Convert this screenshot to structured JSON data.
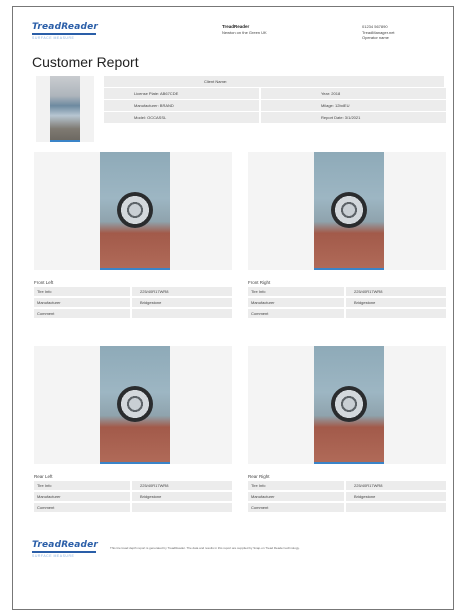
{
  "header": {
    "logo_text": "TreadReader",
    "logo_tag": "SURFACE MEASURE",
    "company_name": "TreadReader",
    "address": "Newton on the Green UK",
    "phone": "01234 567890",
    "email": "TreadManager.net",
    "operator": "Operator name"
  },
  "title": "Customer Report",
  "summary": {
    "client_name": "Client Name:",
    "license_plate": "License Plate: AB67CDE",
    "year": "Year: 2018",
    "manufacturer": "Manufacturer: BRAND",
    "mileage": "Milage: 12bdEU",
    "model": "Model: OCCASSL",
    "report_date": "Report Date: 3/1/2021"
  },
  "tyres": [
    {
      "position": "Front Left",
      "tire_info_label": "Tire Info",
      "tire_info": "225/40R17WR8",
      "manufacturer_label": "Manufacturer",
      "manufacturer": "Bridgestone",
      "comment_label": "Comment",
      "comment": ""
    },
    {
      "position": "Front Right",
      "tire_info_label": "Tire Info",
      "tire_info": "225/40R17WR8",
      "manufacturer_label": "Manufacturer",
      "manufacturer": "Bridgestone",
      "comment_label": "Comment",
      "comment": ""
    },
    {
      "position": "Rear Left",
      "tire_info_label": "Tire Info",
      "tire_info": "225/40R17WR8",
      "manufacturer_label": "Manufacturer",
      "manufacturer": "Bridgestone",
      "comment_label": "Comment",
      "comment": ""
    },
    {
      "position": "Rear Right",
      "tire_info_label": "Tire Info",
      "tire_info": "225/40R17WR8",
      "manufacturer_label": "Manufacturer",
      "manufacturer": "Bridgestone",
      "comment_label": "Comment",
      "comment": ""
    }
  ],
  "footer": {
    "logo_text": "TreadReader",
    "logo_tag": "SURFACE MEASURE",
    "text": "This tire tread depth report is generated by TreadReader. The data and results in this report are supplied by Snap-on Tread Reader technology."
  },
  "colors": {
    "brand": "#2a5ea8",
    "accent": "#3a84c8",
    "cell": "#ececec"
  }
}
